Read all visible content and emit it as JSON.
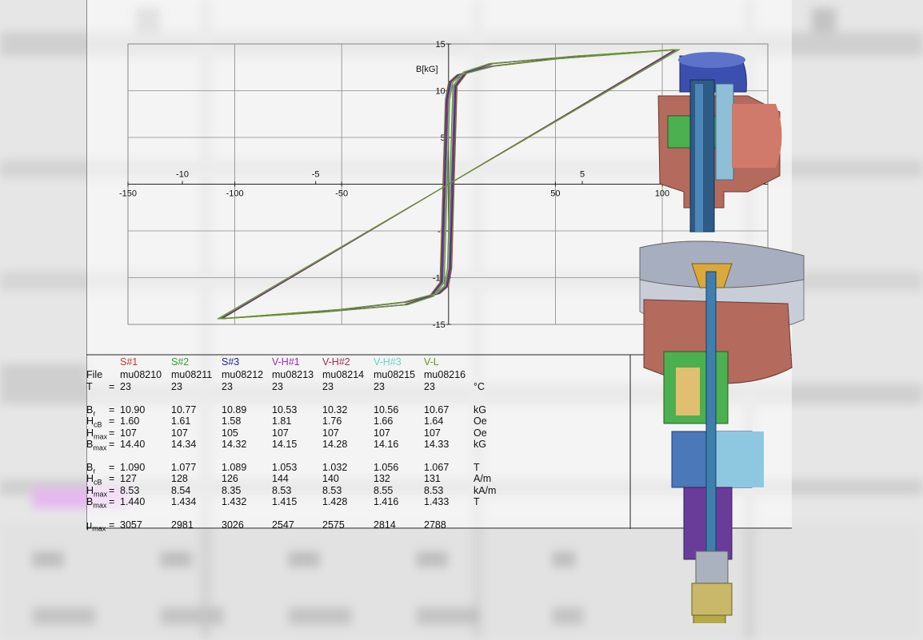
{
  "chart_data": {
    "type": "line",
    "ylabel": "B[kG]",
    "x_primary": {
      "ticks": [
        -150,
        -100,
        -50,
        50,
        100
      ],
      "range": [
        -150,
        100
      ]
    },
    "x_secondary": {
      "ticks": [
        -10,
        -5,
        5
      ],
      "range": [
        -10,
        5
      ]
    },
    "y": {
      "ticks": [
        15,
        10,
        5,
        -5,
        -10,
        -15
      ],
      "range": [
        -15,
        15
      ]
    },
    "grid": true,
    "series": [
      {
        "name": "S#1",
        "color": "#c0392b"
      },
      {
        "name": "S#2",
        "color": "#2e9e3b"
      },
      {
        "name": "S#3",
        "color": "#1f1f99"
      },
      {
        "name": "V-H#1",
        "color": "#9b2fa8"
      },
      {
        "name": "V-H#2",
        "color": "#9b2f50"
      },
      {
        "name": "V-H#3",
        "color": "#62d6c8"
      },
      {
        "name": "V-L",
        "color": "#6b8e23"
      }
    ],
    "curve_points_upper": [
      [
        -107,
        -14.4
      ],
      [
        -60,
        -13.7
      ],
      [
        -20,
        -12.9
      ],
      [
        -8,
        -12.0
      ],
      [
        -3,
        -10.5
      ],
      [
        -1.6,
        0
      ],
      [
        -0.5,
        9.0
      ],
      [
        1,
        10.9
      ],
      [
        5,
        11.7
      ],
      [
        20,
        12.6
      ],
      [
        50,
        13.4
      ],
      [
        107,
        14.4
      ]
    ],
    "curve_points_lower": [
      [
        -107,
        -14.4
      ],
      [
        -50,
        -13.4
      ],
      [
        -20,
        -12.6
      ],
      [
        -5,
        -11.7
      ],
      [
        -1,
        -10.9
      ],
      [
        0.5,
        -9.0
      ],
      [
        1.6,
        0
      ],
      [
        3,
        10.5
      ],
      [
        8,
        12.0
      ],
      [
        20,
        12.9
      ],
      [
        60,
        13.7
      ],
      [
        107,
        14.4
      ]
    ]
  },
  "table": {
    "columns": [
      {
        "name": "S#1",
        "color": "#c0392b"
      },
      {
        "name": "S#2",
        "color": "#2e9e3b"
      },
      {
        "name": "S#3",
        "color": "#1f1f99"
      },
      {
        "name": "V-H#1",
        "color": "#9b2fa8"
      },
      {
        "name": "V-H#2",
        "color": "#9b2f50"
      },
      {
        "name": "V-H#3",
        "color": "#62d6c8"
      },
      {
        "name": "V-L",
        "color": "#6b8e23"
      }
    ],
    "rows": [
      {
        "label": "File",
        "sub": "",
        "eq": "",
        "values": [
          "mu08210",
          "mu08211",
          "mu08212",
          "mu08213",
          "mu08214",
          "mu08215",
          "mu08216"
        ],
        "unit": ""
      },
      {
        "label": "T",
        "sub": "",
        "eq": "=",
        "values": [
          "23",
          "23",
          "23",
          "23",
          "23",
          "23",
          "23"
        ],
        "unit": "°C"
      },
      {
        "label": "B",
        "sub": "r",
        "eq": "=",
        "values": [
          "10.90",
          "10.77",
          "10.89",
          "10.53",
          "10.32",
          "10.56",
          "10.67"
        ],
        "unit": "kG"
      },
      {
        "label": "H",
        "sub": "cB",
        "eq": "=",
        "values": [
          "1.60",
          "1.61",
          "1.58",
          "1.81",
          "1.76",
          "1.66",
          "1.64"
        ],
        "unit": "Oe"
      },
      {
        "label": "H",
        "sub": "max",
        "eq": "=",
        "values": [
          "107",
          "107",
          "105",
          "107",
          "107",
          "107",
          "107"
        ],
        "unit": "Oe"
      },
      {
        "label": "B",
        "sub": "max",
        "eq": "=",
        "values": [
          "14.40",
          "14.34",
          "14.32",
          "14.15",
          "14.28",
          "14.16",
          "14.33"
        ],
        "unit": "kG"
      },
      {
        "label": "B",
        "sub": "r",
        "eq": "=",
        "values": [
          "1.090",
          "1.077",
          "1.089",
          "1.053",
          "1.032",
          "1.056",
          "1.067"
        ],
        "unit": "T"
      },
      {
        "label": "H",
        "sub": "cB",
        "eq": "=",
        "values": [
          "127",
          "128",
          "126",
          "144",
          "140",
          "132",
          "131"
        ],
        "unit": "A/m"
      },
      {
        "label": "H",
        "sub": "max",
        "eq": "=",
        "values": [
          "8.53",
          "8.54",
          "8.35",
          "8.53",
          "8.53",
          "8.55",
          "8.53"
        ],
        "unit": "kA/m"
      },
      {
        "label": "B",
        "sub": "max",
        "eq": "=",
        "values": [
          "1.440",
          "1.434",
          "1.432",
          "1.415",
          "1.428",
          "1.416",
          "1.433"
        ],
        "unit": "T"
      },
      {
        "label": "μ",
        "sub": "max",
        "eq": "=",
        "values": [
          "3057",
          "2981",
          "3026",
          "2547",
          "2575",
          "2814",
          "2788"
        ],
        "unit": ""
      }
    ]
  }
}
